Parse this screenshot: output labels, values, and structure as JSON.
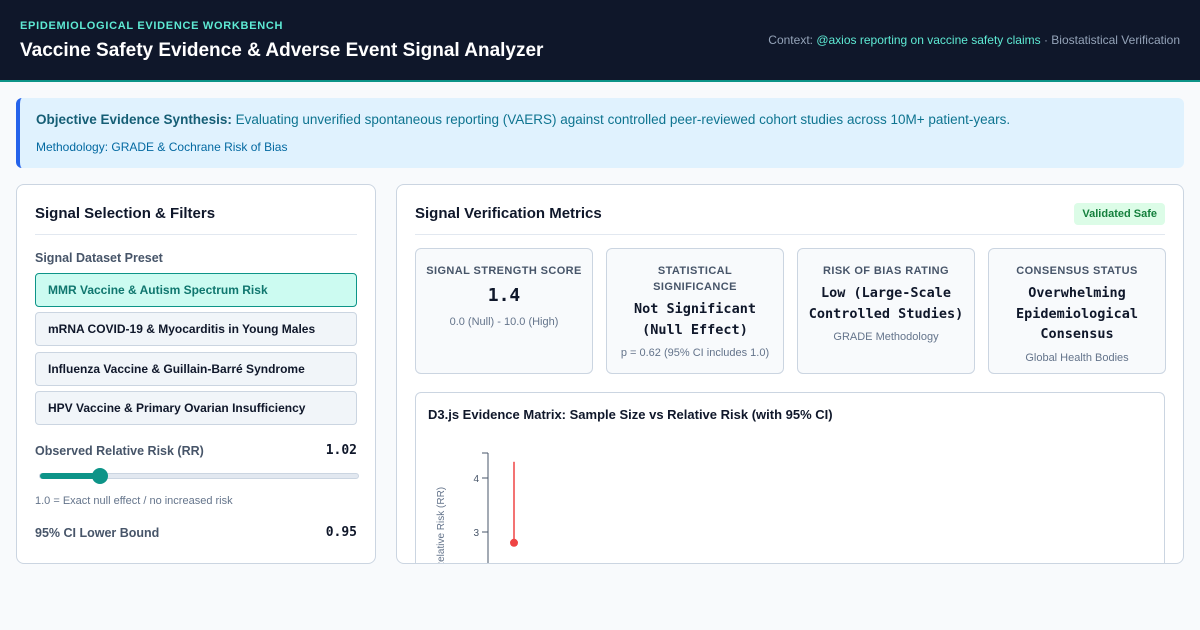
{
  "header": {
    "eyebrow": "EPIDEMIOLOGICAL EVIDENCE WORKBENCH",
    "title": "Vaccine Safety Evidence & Adverse Event Signal Analyzer",
    "context_prefix": "Context: ",
    "context_link": "@axios reporting on vaccine safety claims",
    "context_suffix": " · Biostatistical Verification"
  },
  "banner": {
    "strong": "Objective Evidence Synthesis:",
    "text": " Evaluating unverified spontaneous reporting (VAERS) against controlled peer-reviewed cohort studies across 10M+ patient-years.",
    "methodology": "Methodology: GRADE & Cochrane Risk of Bias"
  },
  "left": {
    "title": "Signal Selection & Filters",
    "preset_label": "Signal Dataset Preset",
    "presets": [
      "MMR Vaccine & Autism Spectrum Risk",
      "mRNA COVID-19 & Myocarditis in Young Males",
      "Influenza Vaccine & Guillain-Barré Syndrome",
      "HPV Vaccine & Primary Ovarian Insufficiency"
    ],
    "rr_label": "Observed Relative Risk (RR)",
    "rr_value": "1.02",
    "rr_fraction": 0.19,
    "rr_hint": "1.0 = Exact null effect / no increased risk",
    "ci_label": "95% CI Lower Bound",
    "ci_value": "0.95"
  },
  "right": {
    "title": "Signal Verification Metrics",
    "badge": "Validated Safe",
    "metrics": [
      {
        "label": "Signal Strength Score",
        "value": "1.4",
        "sub": "0.0 (Null) - 10.0 (High)"
      },
      {
        "label": "Statistical Significance",
        "value": "Not Significant (Null Effect)",
        "sub": "p = 0.62 (95% CI includes 1.0)"
      },
      {
        "label": "Risk of Bias Rating",
        "value": "Low (Large-Scale Controlled Studies)",
        "sub": "GRADE Methodology"
      },
      {
        "label": "Consensus Status",
        "value": "Overwhelming Epidemiological Consensus",
        "sub": "Global Health Bodies"
      }
    ],
    "chart_title": "D3.js Evidence Matrix: Sample Size vs Relative Risk (with 95% CI)"
  },
  "colors": {
    "accent": "#0d9488",
    "header_bg": "#0f172a",
    "point": "#ef4444"
  },
  "chart_data": {
    "type": "scatter",
    "title": "D3.js Evidence Matrix: Sample Size vs Relative Risk (with 95% CI)",
    "ylabel": "Relative Risk (RR)",
    "y_ticks": [
      "4",
      "3"
    ],
    "visible_y_range": [
      2.6,
      4.5
    ],
    "points": [
      {
        "rr": 2.8,
        "ci_high": 4.3
      }
    ]
  }
}
